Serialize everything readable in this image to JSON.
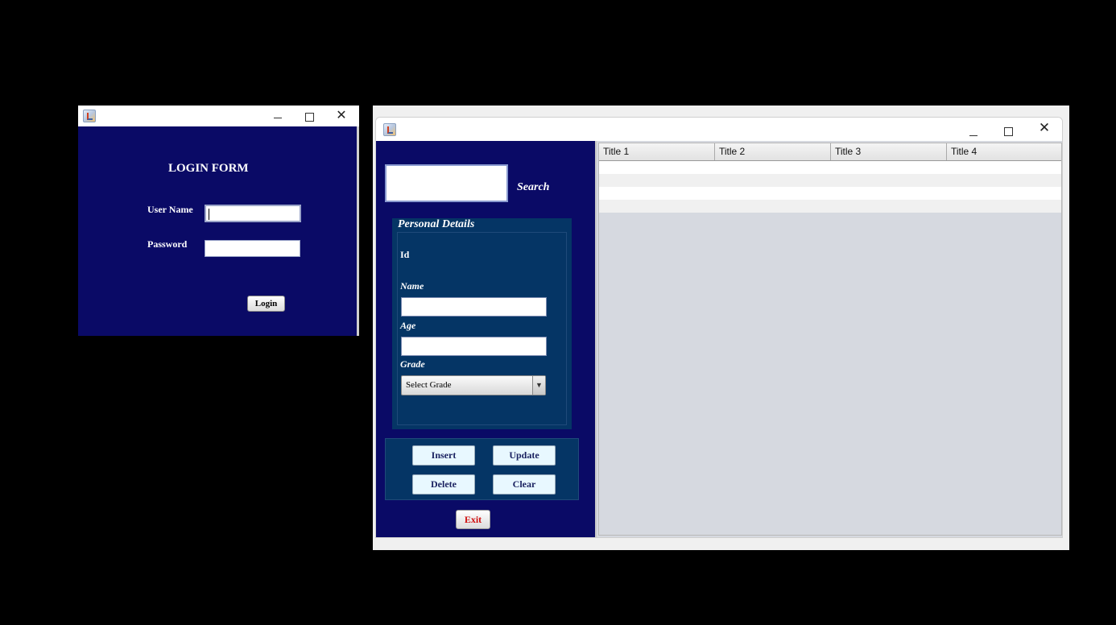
{
  "login_window": {
    "form_title": "LOGIN FORM",
    "username_label": "User Name",
    "username_value": "",
    "password_label": "Password",
    "password_value": "",
    "login_button": "Login",
    "controls": {
      "minimize": "–",
      "maximize": "",
      "close": "✕"
    }
  },
  "main_window": {
    "controls": {
      "minimize": "–",
      "maximize": "",
      "close": "✕"
    },
    "search": {
      "value": "",
      "label": "Search"
    },
    "personal_details": {
      "title": "Personal Details",
      "id_label": "Id",
      "name_label": "Name",
      "name_value": "",
      "age_label": "Age",
      "age_value": "",
      "grade_label": "Grade",
      "grade_selected": "Select Grade"
    },
    "buttons": {
      "insert": "Insert",
      "update": "Update",
      "delete": "Delete",
      "clear": "Clear",
      "exit": "Exit"
    },
    "table": {
      "columns": [
        "Title 1",
        "Title 2",
        "Title 3",
        "Title 4"
      ],
      "rows": [
        [
          "",
          "",
          "",
          ""
        ],
        [
          "",
          "",
          "",
          ""
        ],
        [
          "",
          "",
          "",
          ""
        ],
        [
          "",
          "",
          "",
          ""
        ]
      ]
    }
  },
  "colors": {
    "panel_navy": "#0a0a66",
    "details_blue": "#053565",
    "exit_red": "#d01010",
    "table_bg": "#d6d9e0"
  }
}
